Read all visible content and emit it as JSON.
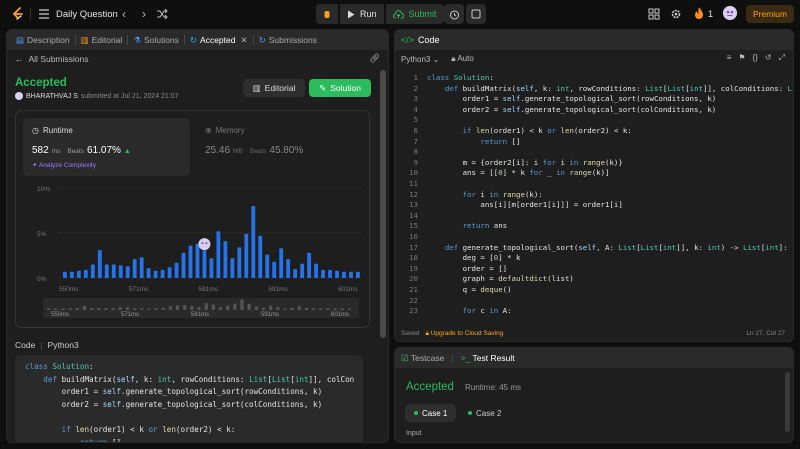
{
  "topbar": {
    "title": "Daily Question",
    "run_label": "Run",
    "submit_label": "Submit",
    "streak": "1",
    "premium_label": "Premium"
  },
  "left": {
    "tabs": [
      "Description",
      "Editorial",
      "Solutions",
      "Accepted",
      "Submissions"
    ],
    "all_submissions": "All Submissions",
    "status": "Accepted",
    "user": "BHARATHVAJ S",
    "submitted_text": "submitted at Jul 21, 2024 21:57",
    "editorial_btn": "Editorial",
    "solution_btn": "Solution",
    "runtime": {
      "title": "Runtime",
      "value": "582",
      "unit": "ms",
      "beats_label": "Beats",
      "beats": "61.07%",
      "analyze": "Analyze Complexity"
    },
    "memory": {
      "title": "Memory",
      "value": "25.46",
      "unit": "MB",
      "beats_label": "Beats",
      "beats": "45.80%"
    },
    "code_label": "Code",
    "code_lang": "Python3",
    "code_lines": [
      "class Solution:",
      "    def buildMatrix(self, k: int, rowConditions: List[List[int]], colCon",
      "        order1 = self.generate_topological_sort(rowConditions, k)",
      "        order2 = self.generate_topological_sort(colConditions, k)",
      "",
      "        if len(order1) < k or len(order2) < k:",
      "            return []"
    ]
  },
  "chart_data": {
    "type": "bar",
    "y_ticks": [
      "10%",
      "5%",
      "0%"
    ],
    "ylim": [
      0,
      10
    ],
    "x_ticks": [
      "550ms",
      "571ms",
      "581ms",
      "591ms",
      "601ms"
    ],
    "mini_ticks": [
      "550ms",
      "571ms",
      "581ms",
      "591ms",
      "601ms"
    ],
    "highlight_index": 20,
    "values": [
      0.7,
      0.7,
      0.8,
      0.9,
      1.5,
      3.1,
      1.5,
      1.5,
      1.4,
      1.3,
      2.1,
      2.3,
      1.1,
      0.8,
      0.9,
      1.2,
      1.7,
      2.8,
      3.6,
      3.8,
      3.1,
      2.2,
      5.2,
      4.1,
      2.2,
      3.4,
      4.9,
      8.0,
      4.7,
      2.6,
      1.8,
      3.3,
      2.1,
      1.0,
      1.6,
      2.8,
      1.6,
      0.9,
      0.9,
      0.8,
      0.7,
      0.7,
      0.7
    ],
    "bar_color": "#2473e8",
    "highlight_color": "#d9cff0"
  },
  "code": {
    "title": "Code",
    "lang": "Python3",
    "auto": "Auto",
    "status_saved": "Saved",
    "status_upgrade": "Upgrade to Cloud Saving",
    "cursor": "Ln 27, Col 27",
    "lines": [
      "class Solution:",
      "    def buildMatrix(self, k: int, rowConditions: List[List[int]], colConditions: List[List",
      "        order1 = self.generate_topological_sort(rowConditions, k)",
      "        order2 = self.generate_topological_sort(colConditions, k)",
      "",
      "        if len(order1) < k or len(order2) < k:",
      "            return []",
      "",
      "        m = {order2[i]: i for i in range(k)}",
      "        ans = [[0] * k for _ in range(k)]",
      "",
      "        for i in range(k):",
      "            ans[i][m[order1[i]]] = order1[i]",
      "",
      "        return ans",
      "",
      "    def generate_topological_sort(self, A: List[List[int]], k: int) -> List[int]:",
      "        deg = [0] * k",
      "        order = []",
      "        graph = defaultdict(list)",
      "        q = deque()",
      "",
      "        for c in A:"
    ]
  },
  "test": {
    "testcase_tab": "Testcase",
    "result_tab": "Test Result",
    "status": "Accepted",
    "runtime": "Runtime: 45 ms",
    "case1": "Case 1",
    "case2": "Case 2",
    "input_label": "Input"
  }
}
